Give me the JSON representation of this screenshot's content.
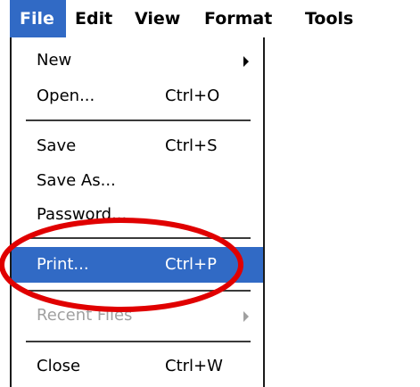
{
  "menubar": {
    "items": [
      {
        "label": "File"
      },
      {
        "label": "Edit"
      },
      {
        "label": "View"
      },
      {
        "label": "Format"
      },
      {
        "label": "Tools"
      }
    ]
  },
  "file_menu": {
    "new": {
      "label": "New"
    },
    "open": {
      "label": "Open...",
      "shortcut": "Ctrl+O"
    },
    "save": {
      "label": "Save",
      "shortcut": "Ctrl+S"
    },
    "save_as": {
      "label": "Save As..."
    },
    "password": {
      "label": "Password..."
    },
    "print": {
      "label": "Print...",
      "shortcut": "Ctrl+P"
    },
    "recent_files": {
      "label": "Recent Files"
    },
    "close": {
      "label": "Close",
      "shortcut": "Ctrl+W"
    }
  },
  "colors": {
    "highlight": "#316ac5",
    "annotation": "#e00000",
    "disabled_text": "#a0a0a0"
  }
}
